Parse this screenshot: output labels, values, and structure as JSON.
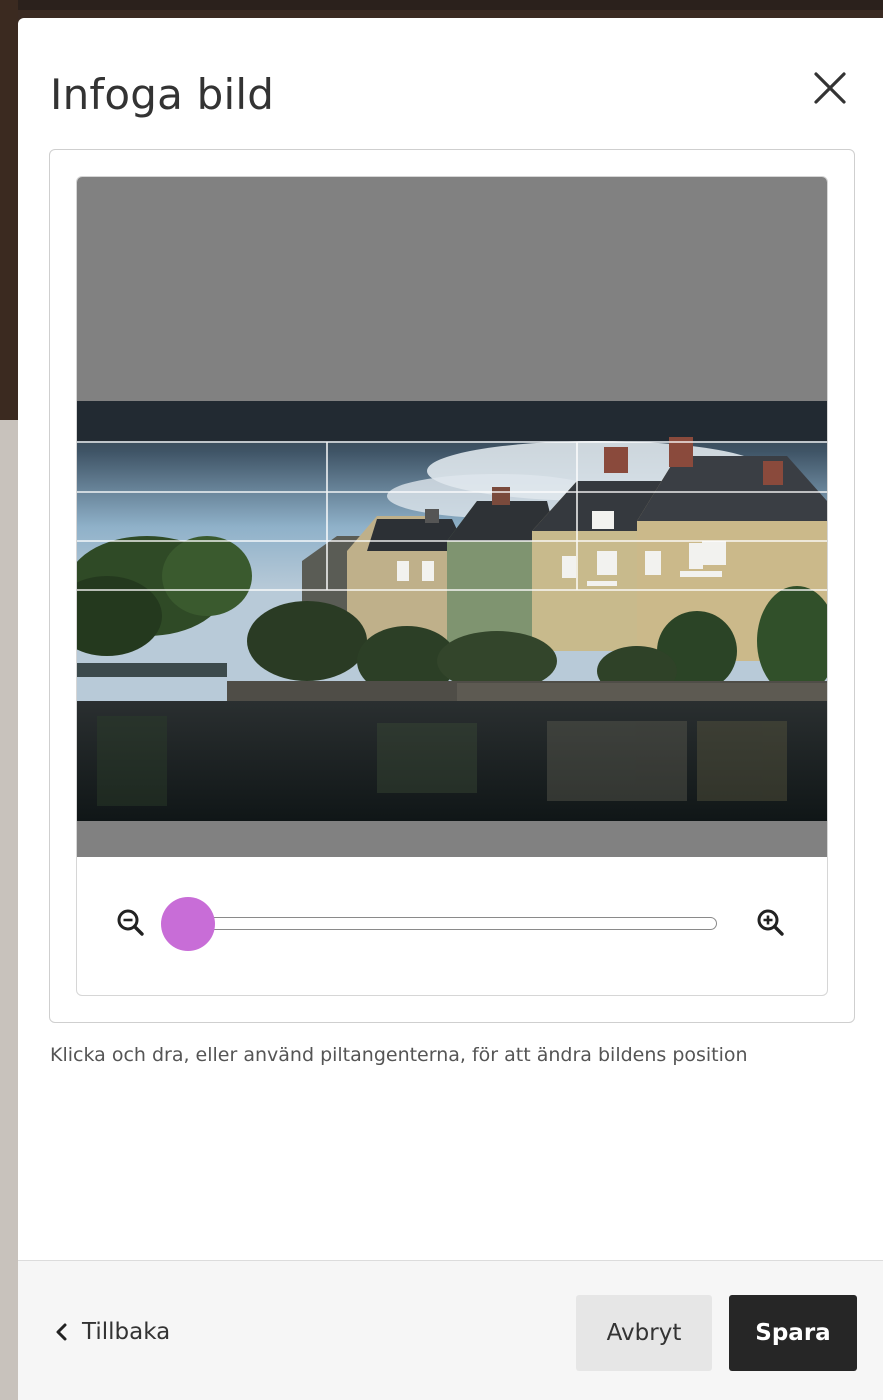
{
  "dialog": {
    "title": "Infoga bild",
    "close_icon": "close-icon"
  },
  "editor": {
    "zoom_out_icon": "zoom-out-icon",
    "zoom_in_icon": "zoom-in-icon",
    "zoom_level": 0,
    "accent_color": "#c86dd7"
  },
  "hint": "Klicka och dra, eller använd piltangenterna, för att ändra bildens position",
  "footer": {
    "back_label": "Tillbaka",
    "back_icon": "chevron-left-icon",
    "cancel_label": "Avbryt",
    "save_label": "Spara"
  }
}
